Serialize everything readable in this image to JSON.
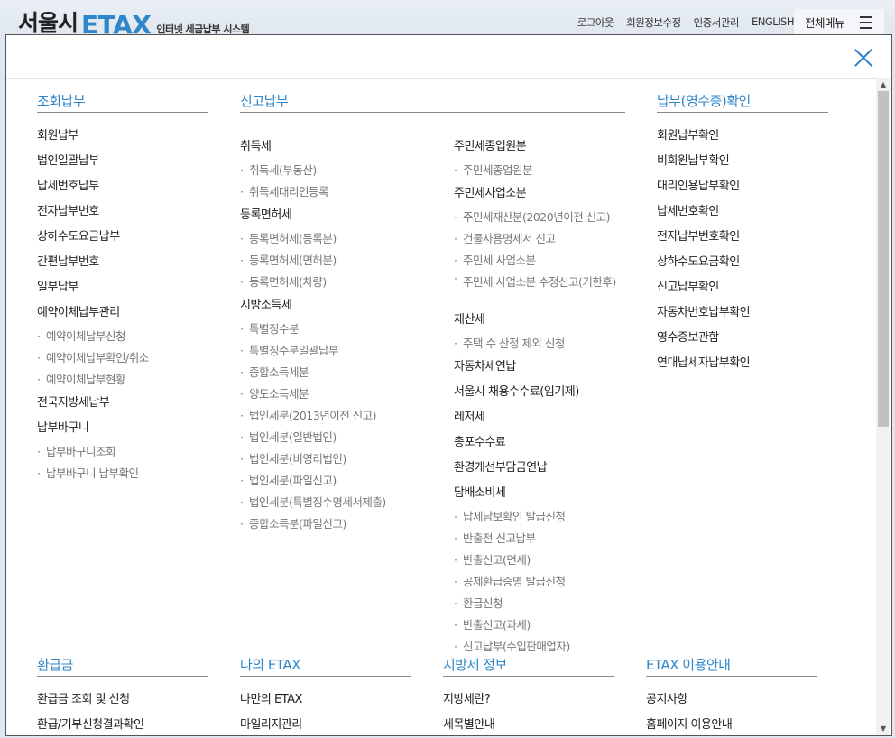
{
  "logo": {
    "seoul": "서울시",
    "etax": "ETAX",
    "sub": "인터넷 세금납부 시스템"
  },
  "topnav": [
    "로그아웃",
    "회원정보수정",
    "인증서관리",
    "ENGLISH"
  ],
  "allmenu_label": "전체메뉴",
  "sections": {
    "inquiry": {
      "title": "조회납부",
      "items": [
        {
          "label": "회원납부",
          "sub": false
        },
        {
          "label": "법인일괄납부",
          "sub": false
        },
        {
          "label": "납세번호납부",
          "sub": false
        },
        {
          "label": "전자납부번호",
          "sub": false
        },
        {
          "label": "상하수도요금납부",
          "sub": false
        },
        {
          "label": "간편납부번호",
          "sub": false
        },
        {
          "label": "일부납부",
          "sub": false
        },
        {
          "label": "예약이체납부관리",
          "sub": false
        },
        {
          "label": "예약이체납부신청",
          "sub": true
        },
        {
          "label": "예약이체납부확인/취소",
          "sub": true
        },
        {
          "label": "예약이체납부현황",
          "sub": true
        },
        {
          "label": "전국지방세납부",
          "sub": false
        },
        {
          "label": "납부바구니",
          "sub": false
        },
        {
          "label": "납부바구니조회",
          "sub": true
        },
        {
          "label": "납부바구니 납부확인",
          "sub": true
        }
      ]
    },
    "report": {
      "title": "신고납부",
      "col1": [
        {
          "label": "취득세",
          "sub": false
        },
        {
          "label": "취득세(부동산)",
          "sub": true
        },
        {
          "label": "취득세대리인등록",
          "sub": true
        },
        {
          "label": "등록면허세",
          "sub": false
        },
        {
          "label": "등록면허세(등록분)",
          "sub": true
        },
        {
          "label": "등록면허세(면허분)",
          "sub": true
        },
        {
          "label": "등록면허세(차량)",
          "sub": true
        },
        {
          "label": "지방소득세",
          "sub": false
        },
        {
          "label": "특별징수분",
          "sub": true
        },
        {
          "label": "특별징수분일괄납부",
          "sub": true
        },
        {
          "label": "종합소득세분",
          "sub": true
        },
        {
          "label": "양도소득세분",
          "sub": true
        },
        {
          "label": "법인세분(2013년이전 신고)",
          "sub": true
        },
        {
          "label": "법인세분(일반법인)",
          "sub": true
        },
        {
          "label": "법인세분(비영리법인)",
          "sub": true
        },
        {
          "label": "법인세분(파일신고)",
          "sub": true
        },
        {
          "label": "법인세분(특별징수명세서제출)",
          "sub": true
        },
        {
          "label": "종합소득분(파일신고)",
          "sub": true
        }
      ],
      "col2": [
        {
          "label": "주민세종업원분",
          "sub": false
        },
        {
          "label": "주민세종업원분",
          "sub": true
        },
        {
          "label": "주민세사업소분",
          "sub": false
        },
        {
          "label": "주민세재산분(2020년이전 신고)",
          "sub": true
        },
        {
          "label": "건물사용명세서 신고",
          "sub": true
        },
        {
          "label": "주민세 사업소분",
          "sub": true
        },
        {
          "label": "주민세 사업소분 수정신고(기한후)",
          "sub": true,
          "two": true
        },
        {
          "label": "재산세",
          "sub": false
        },
        {
          "label": "주택 수 산정 제외 신청",
          "sub": true
        },
        {
          "label": "자동차세연납",
          "sub": false
        },
        {
          "label": "서울시 채용수수료(임기제)",
          "sub": false
        },
        {
          "label": "레저세",
          "sub": false
        },
        {
          "label": "총포수수료",
          "sub": false
        },
        {
          "label": "환경개선부담금연납",
          "sub": false
        },
        {
          "label": "담배소비세",
          "sub": false
        },
        {
          "label": "납세담보확인 발급신청",
          "sub": true
        },
        {
          "label": "반출전 신고납부",
          "sub": true
        },
        {
          "label": "반출신고(면세)",
          "sub": true
        },
        {
          "label": "공제환급증명 발급신청",
          "sub": true
        },
        {
          "label": "환급신청",
          "sub": true
        },
        {
          "label": "반출신고(과세)",
          "sub": true
        },
        {
          "label": "신고납부(수입판매업자)",
          "sub": true
        }
      ]
    },
    "receipt": {
      "title": "납부(영수증)확인",
      "items": [
        {
          "label": "회원납부확인",
          "sub": false
        },
        {
          "label": "비회원납부확인",
          "sub": false
        },
        {
          "label": "대리인용납부확인",
          "sub": false
        },
        {
          "label": "납세번호확인",
          "sub": false
        },
        {
          "label": "전자납부번호확인",
          "sub": false
        },
        {
          "label": "상하수도요금확인",
          "sub": false
        },
        {
          "label": "신고납부확인",
          "sub": false
        },
        {
          "label": "자동차번호납부확인",
          "sub": false
        },
        {
          "label": "영수증보관함",
          "sub": false
        },
        {
          "label": "연대납세자납부확인",
          "sub": false
        }
      ]
    },
    "refund": {
      "title": "환급금",
      "items": [
        {
          "label": "환급금 조회 및 신청",
          "sub": false
        },
        {
          "label": "환급/기부신청결과확인",
          "sub": false
        }
      ]
    },
    "my_etax": {
      "title": "나의 ETAX",
      "items": [
        {
          "label": "나만의 ETAX",
          "sub": false
        },
        {
          "label": "마일리지관리",
          "sub": false
        }
      ]
    },
    "local_tax": {
      "title": "지방세 정보",
      "items": [
        {
          "label": "지방세란?",
          "sub": false
        },
        {
          "label": "세목별안내",
          "sub": false
        }
      ]
    },
    "guide": {
      "title": "ETAX 이용안내",
      "items": [
        {
          "label": "공지사항",
          "sub": false
        },
        {
          "label": "홈페이지 이용안내",
          "sub": false
        }
      ]
    }
  }
}
